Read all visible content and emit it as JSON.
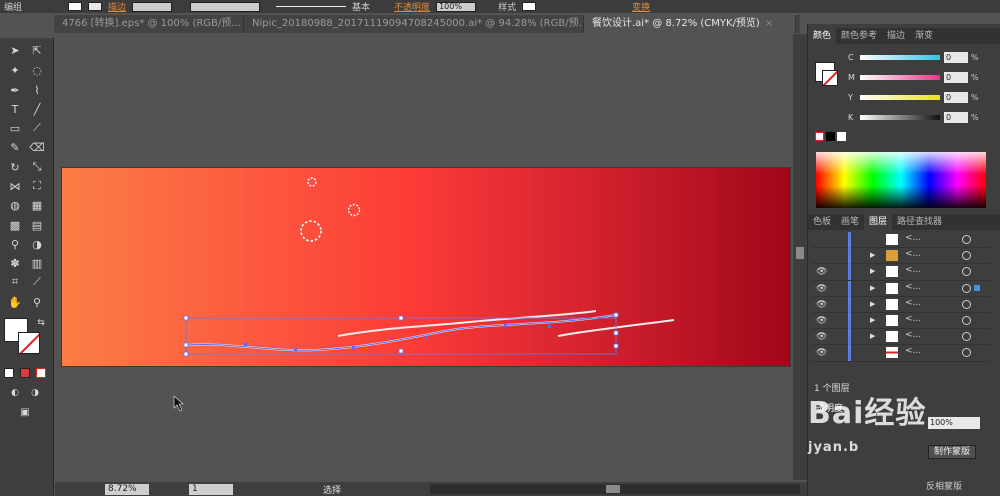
{
  "topbar": {
    "label_left": "编组",
    "stroke_label": "描边",
    "stroke_style": "基本",
    "opacity_label": "不透明度",
    "opacity_value": "100%",
    "style_label": "样式",
    "transform_label": "变换"
  },
  "tabs": [
    {
      "label": "4766 [转换].eps* @ 100% (RGB/预...",
      "close": "×"
    },
    {
      "label": "Nipic_20180988_20171119094708245000.ai* @ 94.28% (RGB/预...",
      "close": "×"
    },
    {
      "label": "餐饮设计.ai* @ 8.72% (CMYK/预览)",
      "close": "×",
      "active": true
    }
  ],
  "status": {
    "zoom": "8.72%",
    "page": "1",
    "mode": "选择"
  },
  "right_panel": {
    "color_tabs": [
      "颜色",
      "颜色参考",
      "描边",
      "渐变"
    ],
    "channels": [
      {
        "label": "C",
        "value": "0",
        "unit": "%",
        "color": "#33c4e8"
      },
      {
        "label": "M",
        "value": "0",
        "unit": "%",
        "color": "#e8358a"
      },
      {
        "label": "Y",
        "value": "0",
        "unit": "%",
        "color": "#e8e020"
      },
      {
        "label": "K",
        "value": "0",
        "unit": "%",
        "color": "#111111"
      }
    ],
    "layer_tabs": [
      "色板",
      "画笔",
      "图层",
      "路径查找器"
    ],
    "layers": [
      {
        "name": "<...",
        "visible": false,
        "expandable": false,
        "thumb": "white"
      },
      {
        "name": "<...",
        "visible": false,
        "expandable": true,
        "thumb": "gold"
      },
      {
        "name": "<...",
        "visible": true,
        "expandable": true,
        "thumb": "white"
      },
      {
        "name": "<...",
        "visible": true,
        "expandable": true,
        "thumb": "white",
        "selected": true
      },
      {
        "name": "<...",
        "visible": true,
        "expandable": true,
        "thumb": "white"
      },
      {
        "name": "<...",
        "visible": true,
        "expandable": true,
        "thumb": "white"
      },
      {
        "name": "<...",
        "visible": true,
        "expandable": true,
        "thumb": "white"
      },
      {
        "name": "<...",
        "visible": true,
        "expandable": false,
        "thumb": "red"
      }
    ],
    "layer_count": "1 个图层",
    "transparency_tab": "透明度",
    "transparency_value": "100%",
    "make_mask": "制作蒙版",
    "invert_mask": "反相蒙版"
  },
  "watermark": {
    "text": "Bai经验",
    "sub": "jyan.b"
  }
}
